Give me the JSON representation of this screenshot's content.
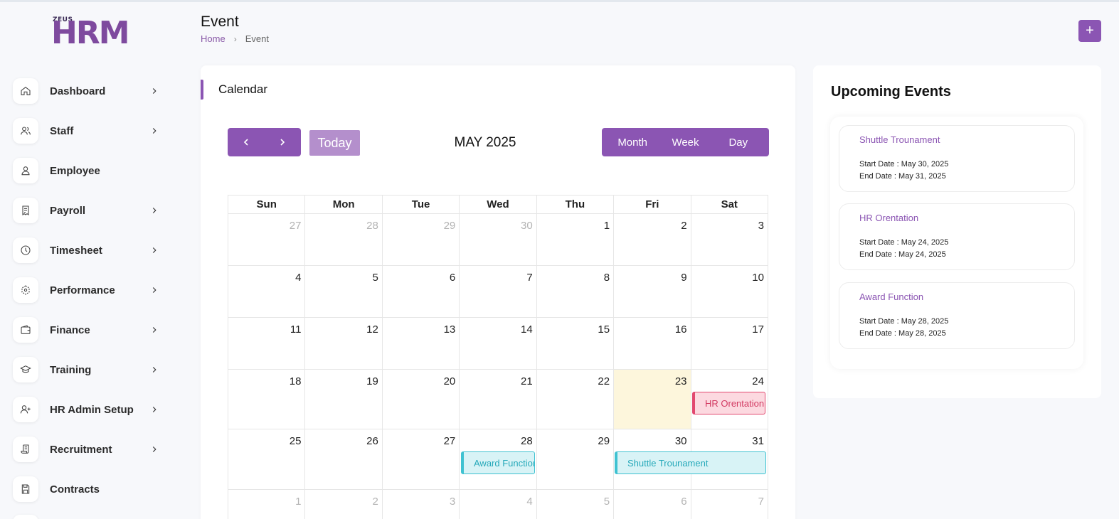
{
  "logo": {
    "small": "ZEUS",
    "big": "HRM"
  },
  "sidebar": {
    "items": [
      {
        "label": "Dashboard",
        "icon": "home-icon",
        "has_chevron": true
      },
      {
        "label": "Staff",
        "icon": "users-icon",
        "has_chevron": true
      },
      {
        "label": "Employee",
        "icon": "user-icon",
        "has_chevron": false
      },
      {
        "label": " Payroll",
        "icon": "receipt-icon",
        "has_chevron": true
      },
      {
        "label": "Timesheet",
        "icon": "clock-icon",
        "has_chevron": true
      },
      {
        "label": "Performance",
        "icon": "performance-icon",
        "has_chevron": true
      },
      {
        "label": "Finance",
        "icon": "wallet-icon",
        "has_chevron": true
      },
      {
        "label": "Training",
        "icon": "graduation-cap-icon",
        "has_chevron": true
      },
      {
        "label": " HR Admin Setup",
        "icon": "user-plus-icon",
        "has_chevron": true
      },
      {
        "label": "Recruitment",
        "icon": "scroll-icon",
        "has_chevron": true
      },
      {
        "label": "Contracts",
        "icon": "save-icon",
        "has_chevron": false
      }
    ]
  },
  "header": {
    "title": "Event",
    "breadcrumb": {
      "home": "Home",
      "separator": "›",
      "current": "Event"
    },
    "add_label": "+"
  },
  "calendar": {
    "title": "Calendar",
    "today_label": "Today",
    "month_label": "MAY 2025",
    "views": [
      "Month",
      "Week",
      "Day"
    ],
    "weekdays": [
      "Sun",
      "Mon",
      "Tue",
      "Wed",
      "Thu",
      "Fri",
      "Sat"
    ],
    "weeks": [
      [
        {
          "d": "27",
          "o": true
        },
        {
          "d": "28",
          "o": true
        },
        {
          "d": "29",
          "o": true
        },
        {
          "d": "30",
          "o": true
        },
        {
          "d": "1"
        },
        {
          "d": "2"
        },
        {
          "d": "3"
        }
      ],
      [
        {
          "d": "4"
        },
        {
          "d": "5"
        },
        {
          "d": "6"
        },
        {
          "d": "7"
        },
        {
          "d": "8"
        },
        {
          "d": "9"
        },
        {
          "d": "10"
        }
      ],
      [
        {
          "d": "11"
        },
        {
          "d": "12"
        },
        {
          "d": "13"
        },
        {
          "d": "14"
        },
        {
          "d": "15"
        },
        {
          "d": "16"
        },
        {
          "d": "17"
        }
      ],
      [
        {
          "d": "18"
        },
        {
          "d": "19"
        },
        {
          "d": "20"
        },
        {
          "d": "21"
        },
        {
          "d": "22"
        },
        {
          "d": "23",
          "t": true
        },
        {
          "d": "24"
        }
      ],
      [
        {
          "d": "25"
        },
        {
          "d": "26"
        },
        {
          "d": "27"
        },
        {
          "d": "28"
        },
        {
          "d": "29"
        },
        {
          "d": "30"
        },
        {
          "d": "31"
        }
      ],
      [
        {
          "d": "1",
          "o": true
        },
        {
          "d": "2",
          "o": true
        },
        {
          "d": "3",
          "o": true
        },
        {
          "d": "4",
          "o": true
        },
        {
          "d": "5",
          "o": true
        },
        {
          "d": "6",
          "o": true
        },
        {
          "d": "7",
          "o": true
        }
      ]
    ],
    "events": [
      {
        "label": "HR Orentation",
        "color": "pink"
      },
      {
        "label": "Award Function",
        "color": "cyan"
      },
      {
        "label": "Shuttle Trounament",
        "color": "cyan"
      }
    ]
  },
  "upcoming": {
    "title": "Upcoming Events",
    "items": [
      {
        "name": "Shuttle Trounament",
        "start": "Start Date : May 30, 2025",
        "end": "End Date : May 31, 2025"
      },
      {
        "name": "HR Orentation",
        "start": "Start Date : May 24, 2025",
        "end": "End Date : May 24, 2025"
      },
      {
        "name": "Award Function",
        "start": "Start Date : May 28, 2025",
        "end": "End Date : May 28, 2025"
      }
    ]
  },
  "colors": {
    "accent": "#8b55b3",
    "today_bg": "#fdf6dc",
    "event_pink": "#e2486f",
    "event_cyan": "#3fc2d1"
  }
}
